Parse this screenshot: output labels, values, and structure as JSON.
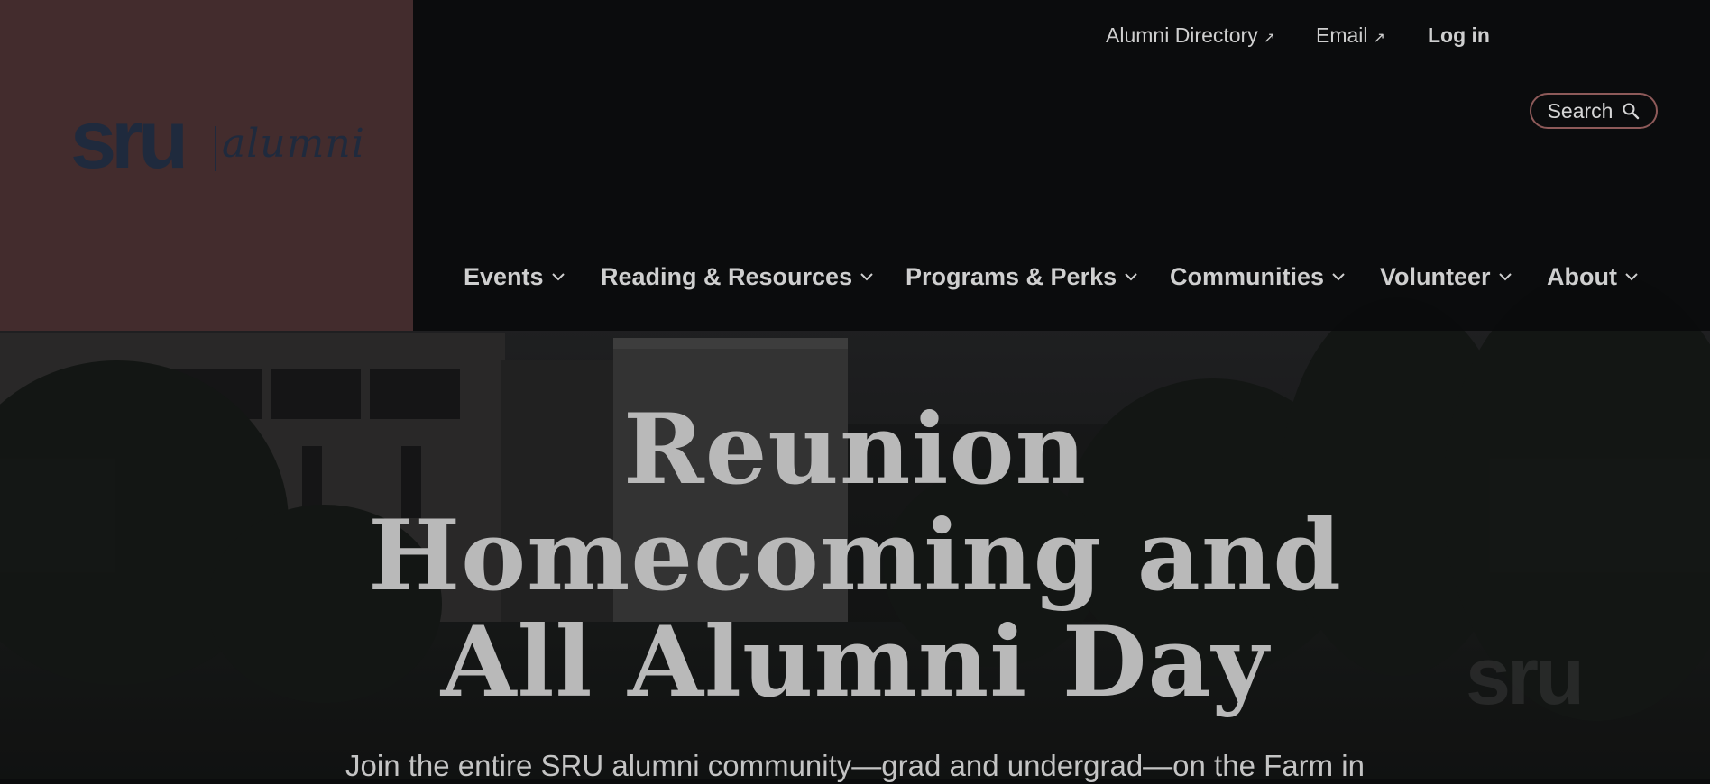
{
  "branding": {
    "logo_wordmark": "sru",
    "logo_script": "alumni",
    "panel_color": "#432c2d",
    "wordmark_color": "#1f2a3d"
  },
  "utility_nav": {
    "alumni_directory": "Alumni Directory",
    "email": "Email",
    "login": "Log in",
    "external_icon": "arrow-up-right-icon"
  },
  "search": {
    "label": "Search",
    "icon": "search-icon",
    "border_color": "#8e5a59"
  },
  "main_nav": {
    "items": [
      {
        "label": "Events"
      },
      {
        "label": "Reading & Resources"
      },
      {
        "label": "Programs & Perks"
      },
      {
        "label": "Communities"
      },
      {
        "label": "Volunteer"
      },
      {
        "label": "About"
      }
    ],
    "dropdown_icon": "chevron-down-icon"
  },
  "hero": {
    "title_lines": [
      "Reunion",
      "Homecoming and",
      "All Alumni Day"
    ],
    "subtitle": "Join the entire SRU alumni community—grad and undergrad—on the Farm in"
  }
}
